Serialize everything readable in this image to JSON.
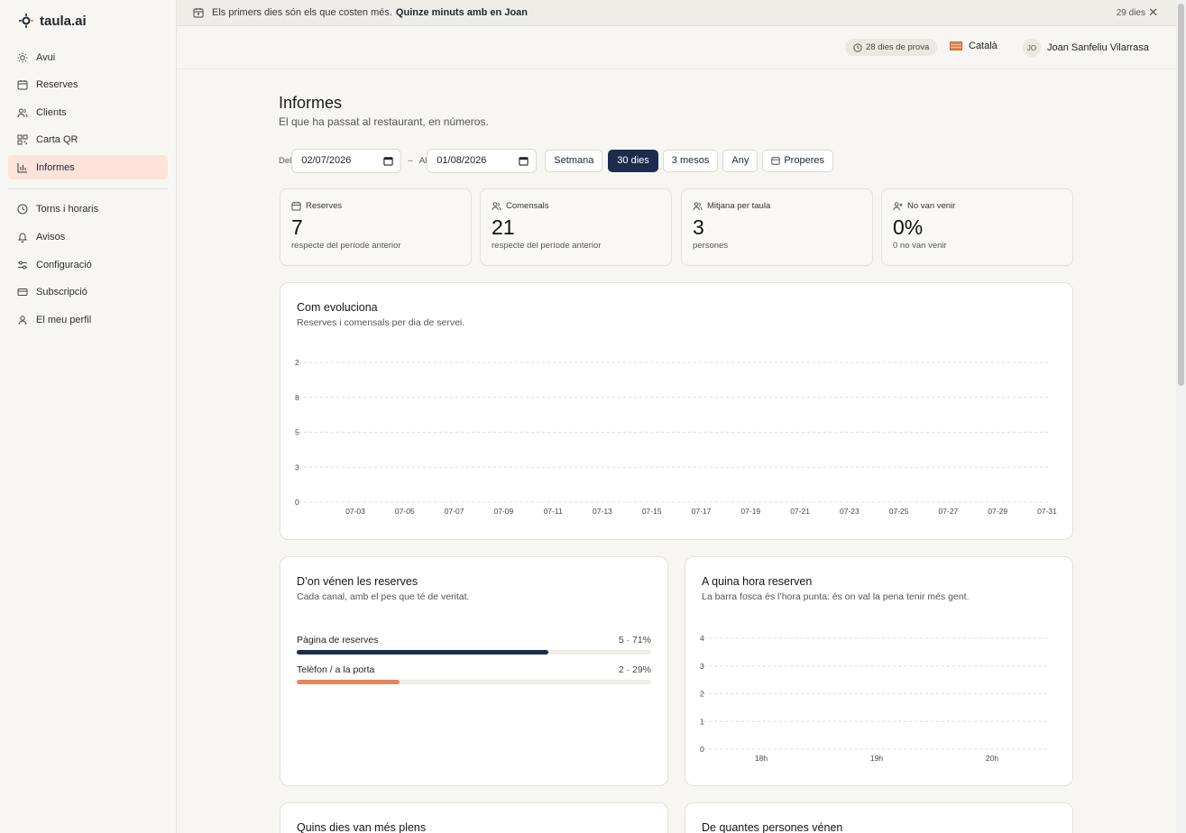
{
  "brand": {
    "name": "taula",
    "suffix": ".ai"
  },
  "nav": {
    "items": [
      {
        "label": "Avui",
        "icon": "sun-icon"
      },
      {
        "label": "Reserves",
        "icon": "calendar-icon"
      },
      {
        "label": "Clients",
        "icon": "users-icon"
      },
      {
        "label": "Carta QR",
        "icon": "qr-icon"
      },
      {
        "label": "Informes",
        "icon": "chart-icon",
        "active": true
      },
      {
        "label": "Torns i horaris",
        "icon": "clock-icon"
      },
      {
        "label": "Avisos",
        "icon": "bell-icon"
      },
      {
        "label": "Configuració",
        "icon": "sliders-icon"
      },
      {
        "label": "Subscripció",
        "icon": "card-icon"
      },
      {
        "label": "El meu perfil",
        "icon": "user-icon"
      }
    ]
  },
  "banner": {
    "text": "Els primers dies són els que costen més.",
    "link": "Quinze minuts amb en Joan",
    "days": "29 dies"
  },
  "topbar": {
    "trial": "28 dies de prova",
    "language": "Català",
    "user_initials": "JO",
    "user_name": "Joan Sanfeliu Vilarrasa"
  },
  "page": {
    "title": "Informes",
    "subtitle": "El que ha passat al restaurant, en números."
  },
  "filters": {
    "from_label": "Del",
    "from_value": "02/07/2026",
    "to_label": "Al",
    "to_value": "01/08/2026",
    "presets": [
      "Setmana",
      "30 dies",
      "3 mesos",
      "Any"
    ],
    "active_preset": "30 dies",
    "upcoming": "Properes"
  },
  "kpis": [
    {
      "label": "Reserves",
      "value": "7",
      "note": "respecte del període anterior",
      "icon": "calendar-icon"
    },
    {
      "label": "Comensals",
      "value": "21",
      "note": "respecte del període anterior",
      "icon": "users-icon"
    },
    {
      "label": "Mitjana per taula",
      "value": "3",
      "note": "persones",
      "icon": "users-icon"
    },
    {
      "label": "No van venir",
      "value": "0%",
      "note": "0 no van venir",
      "icon": "user-x-icon"
    }
  ],
  "evolution": {
    "title": "Com evoluciona",
    "subtitle": "Reserves i comensals per dia de servei."
  },
  "sources": {
    "title": "D’on vénen les reserves",
    "subtitle": "Cada canal, amb el pes que té de veritat."
  },
  "hours": {
    "title": "A quina hora reserven",
    "subtitle": "La barra fosca és l’hora punta: és on val la pena tenir més gent."
  },
  "bottom": {
    "left_title": "Quins dies van més plens",
    "right_title": "De quantes persones vénen"
  },
  "colors": {
    "navy": "#1c2c4c",
    "orange": "#e8845a",
    "active_bg": "#fde3da"
  },
  "chart_data": [
    {
      "type": "line",
      "title": "Com evoluciona",
      "x": [
        "07-03",
        "07-05",
        "07-07",
        "07-09",
        "07-11",
        "07-13",
        "07-15",
        "07-17",
        "07-19",
        "07-21",
        "07-23",
        "07-25",
        "07-27",
        "07-29",
        "07-31"
      ],
      "yticks": [
        "0",
        "3",
        "5",
        "8",
        "2"
      ],
      "grid": true
    },
    {
      "type": "bar",
      "title": "D’on vénen les reserves",
      "categories": [
        "Pàgina de reserves",
        "Telèfon / a la porta"
      ],
      "values": [
        5,
        2
      ],
      "labels": [
        "5 · 71%",
        "2 · 29%"
      ],
      "fractions": [
        0.71,
        0.29
      ]
    },
    {
      "type": "bar",
      "title": "A quina hora reserven",
      "categories": [
        "18h",
        "19h",
        "20h"
      ],
      "yticks": [
        "0",
        "1",
        "2",
        "3",
        "4"
      ],
      "grid": true
    }
  ]
}
